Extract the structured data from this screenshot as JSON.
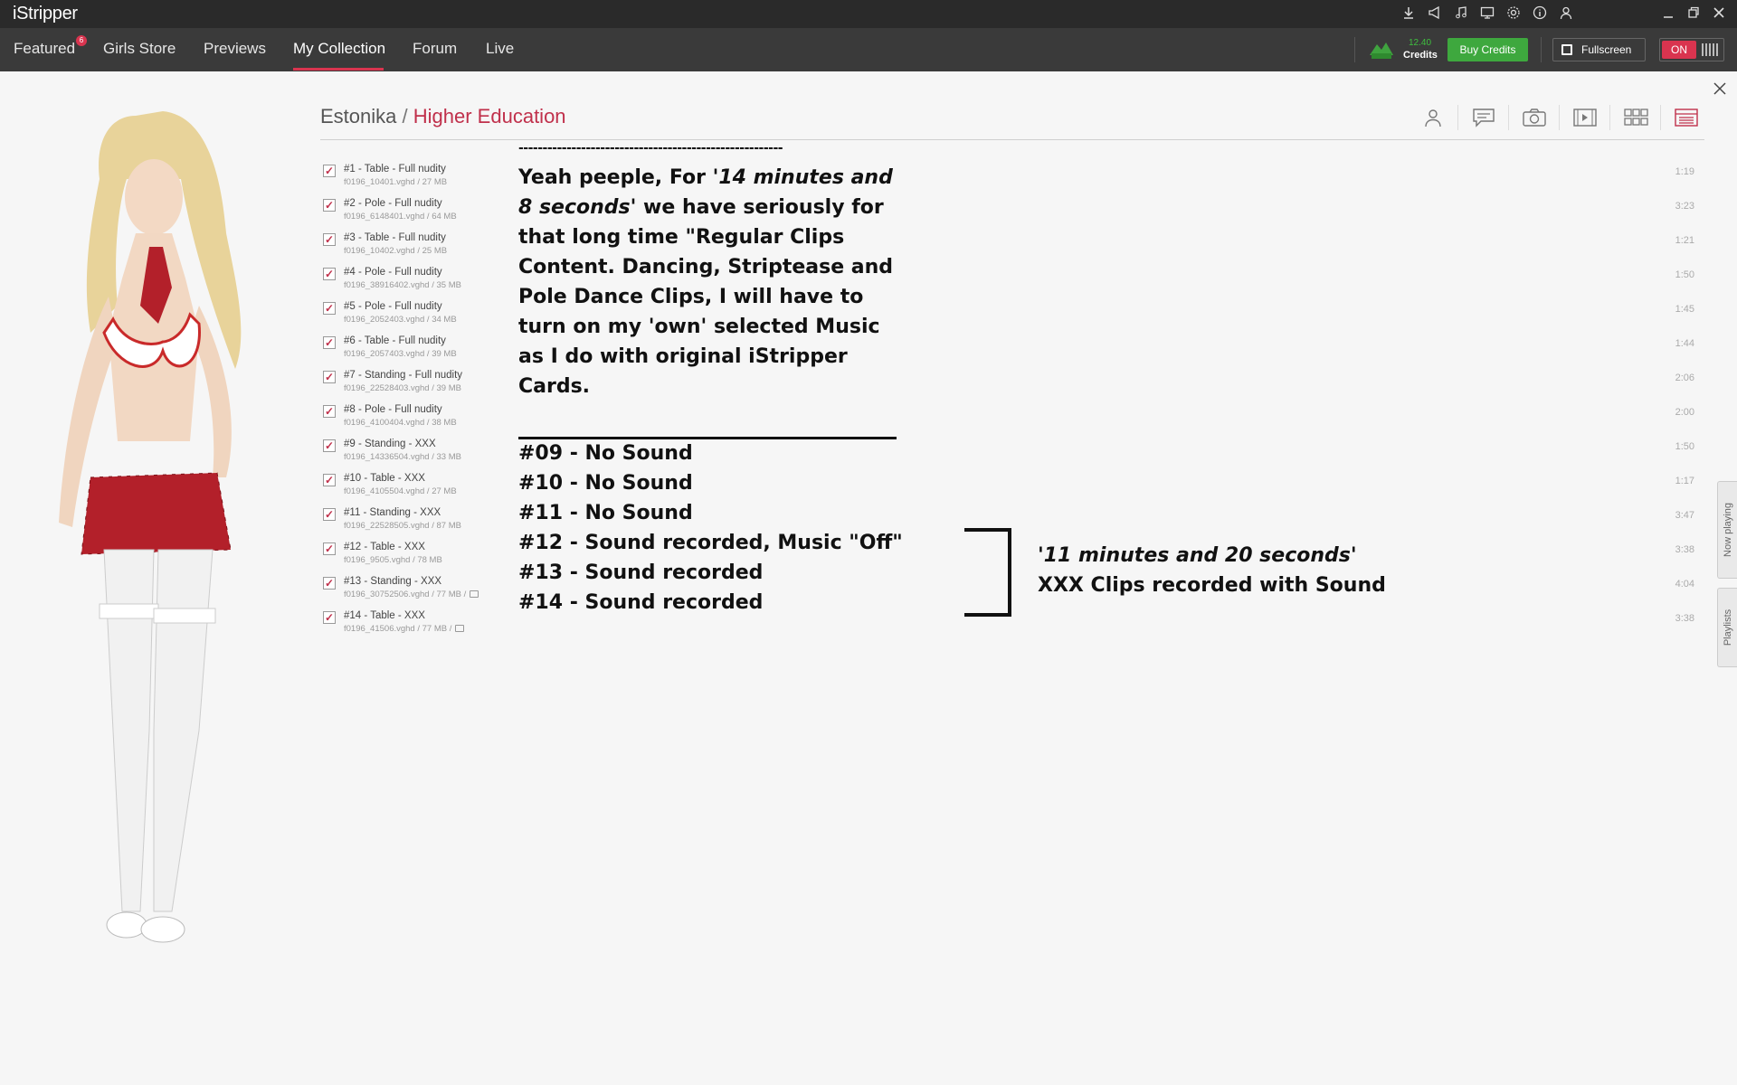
{
  "app": {
    "title": "iStripper"
  },
  "titlebar_icons": [
    "download-icon",
    "announce-icon",
    "music-icon",
    "monitor-icon",
    "settings-icon",
    "info-icon",
    "user-icon"
  ],
  "nav": {
    "items": [
      {
        "label": "Featured",
        "badge": "6"
      },
      {
        "label": "Girls Store"
      },
      {
        "label": "Previews"
      },
      {
        "label": "My Collection",
        "active": true
      },
      {
        "label": "Forum"
      },
      {
        "label": "Live"
      }
    ],
    "credits_amount": "12.40",
    "credits_label": "Credits",
    "buy_credits": "Buy Credits",
    "fullscreen": "Fullscreen",
    "toggle_on": "ON"
  },
  "breadcrumb": {
    "model": "Estonika",
    "separator": "/",
    "card": "Higher Education"
  },
  "clips": [
    {
      "title": "#1 - Table - Full nudity",
      "file": "f0196_10401.vghd / 27 MB",
      "duration": "1:19",
      "locked": false
    },
    {
      "title": "#2 - Pole - Full nudity",
      "file": "f0196_6148401.vghd / 64 MB",
      "duration": "3:23",
      "locked": false
    },
    {
      "title": "#3 - Table - Full nudity",
      "file": "f0196_10402.vghd / 25 MB",
      "duration": "1:21",
      "locked": false
    },
    {
      "title": "#4 - Pole - Full nudity",
      "file": "f0196_38916402.vghd / 35 MB",
      "duration": "1:50",
      "locked": false
    },
    {
      "title": "#5 - Pole - Full nudity",
      "file": "f0196_2052403.vghd / 34 MB",
      "duration": "1:45",
      "locked": false
    },
    {
      "title": "#6 - Table - Full nudity",
      "file": "f0196_2057403.vghd / 39 MB",
      "duration": "1:44",
      "locked": false
    },
    {
      "title": "#7 - Standing - Full nudity",
      "file": "f0196_22528403.vghd / 39 MB",
      "duration": "2:06",
      "locked": false
    },
    {
      "title": "#8 - Pole - Full nudity",
      "file": "f0196_4100404.vghd / 38 MB",
      "duration": "2:00",
      "locked": false
    },
    {
      "title": "#9 - Standing - XXX",
      "file": "f0196_14336504.vghd / 33 MB",
      "duration": "1:50",
      "locked": false
    },
    {
      "title": "#10 - Table - XXX",
      "file": "f0196_4105504.vghd / 27 MB",
      "duration": "1:17",
      "locked": false
    },
    {
      "title": "#11 - Standing - XXX",
      "file": "f0196_22528505.vghd / 87 MB",
      "duration": "3:47",
      "locked": false
    },
    {
      "title": "#12 - Table - XXX",
      "file": "f0196_9505.vghd / 78 MB",
      "duration": "3:38",
      "locked": false
    },
    {
      "title": "#13 - Standing - XXX",
      "file": "f0196_30752506.vghd / 77 MB /",
      "duration": "4:04",
      "locked": true
    },
    {
      "title": "#14 - Table - XXX",
      "file": "f0196_41506.vghd / 77 MB /",
      "duration": "3:38",
      "locked": true
    }
  ],
  "annotation": {
    "dashes": "-------------------------------------------------------",
    "para_pre": "Yeah peeple, For ",
    "para_italic1": "'14 minutes and 8 seconds'",
    "para_post": " we have seriously for that long time \"Regular Clips Content. Dancing, Striptease and Pole Dance Clips, I will have to turn on my 'own' selected Music as I do with original iStripper Cards.",
    "list": [
      "#09 - No Sound",
      "#10 - No Sound",
      "#11 - No Sound",
      "#12 - Sound recorded, Music \"Off\"",
      "#13 - Sound recorded",
      "#14 - Sound recorded"
    ],
    "side_italic": "'11 minutes and 20 seconds'",
    "side_text": "XXX Clips recorded with Sound"
  },
  "side_tabs": {
    "now_playing": "Now playing",
    "playlists": "Playlists"
  },
  "colors": {
    "accent": "#d9344f",
    "buy_green": "#3ea83e",
    "titlebar": "#2a2a2a",
    "navbar": "#3a3a3a"
  }
}
